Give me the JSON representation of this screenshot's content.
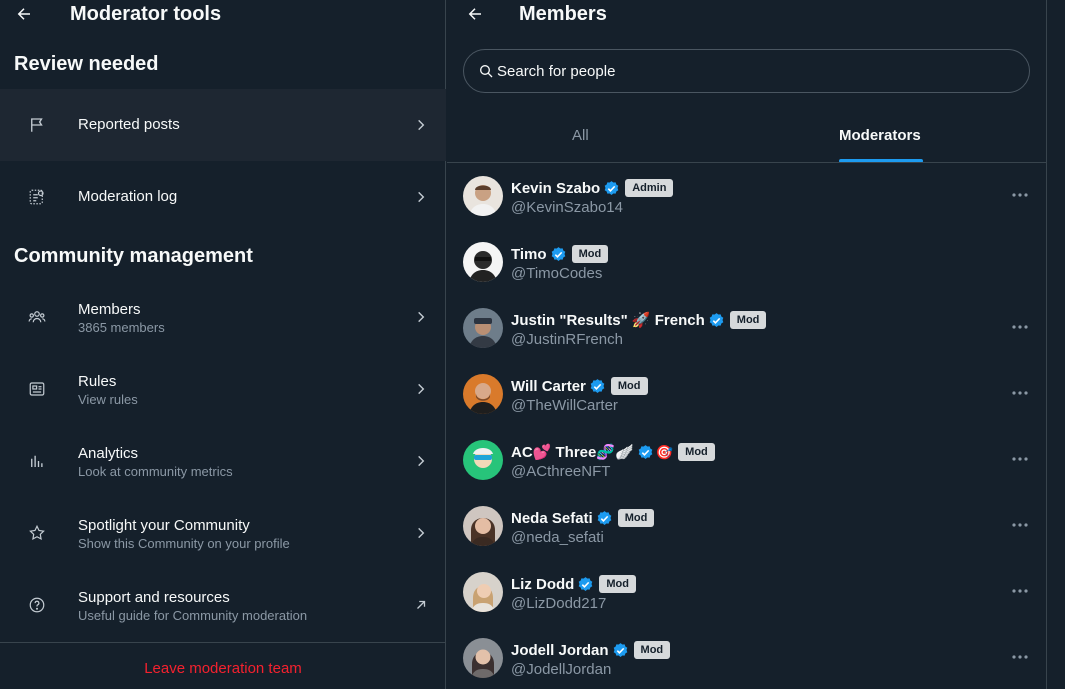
{
  "left": {
    "title": "Moderator tools",
    "back_icon": "arrow-left-icon",
    "review_heading": "Review needed",
    "review_items": [
      {
        "label": "Reported posts",
        "icon": "flag-icon"
      },
      {
        "label": "Moderation log",
        "icon": "moderation-log-icon"
      }
    ],
    "community_heading": "Community management",
    "community_items": [
      {
        "label": "Members",
        "sub": "3865 members",
        "icon": "members-icon"
      },
      {
        "label": "Rules",
        "sub": "View rules",
        "icon": "rules-icon"
      },
      {
        "label": "Analytics",
        "sub": "Look at community metrics",
        "icon": "analytics-icon"
      },
      {
        "label": "Spotlight your Community",
        "sub": "Show this Community on your profile",
        "icon": "star-icon"
      },
      {
        "label": "Support and resources",
        "sub": "Useful guide for Community moderation",
        "icon": "help-icon"
      }
    ],
    "leave_label": "Leave moderation team"
  },
  "right": {
    "title": "Members",
    "search_placeholder": "Search for people",
    "tabs": [
      {
        "label": "All",
        "active": false
      },
      {
        "label": "Moderators",
        "active": true
      }
    ],
    "members": [
      {
        "name": "Kevin Szabo",
        "handle": "@KevinSzabo14",
        "role": "Admin",
        "show_more": true
      },
      {
        "name": "Timo",
        "handle": "@TimoCodes",
        "role": "Mod",
        "show_more": false
      },
      {
        "name": "Justin \"Results\" 🚀 French",
        "handle": "@JustinRFrench",
        "role": "Mod",
        "show_more": true
      },
      {
        "name": "Will Carter",
        "handle": "@TheWillCarter",
        "role": "Mod",
        "show_more": true
      },
      {
        "name": "AC💕 Three🧬🪽",
        "extra_emoji": "🎯",
        "handle": "@ACthreeNFT",
        "role": "Mod",
        "show_more": true
      },
      {
        "name": "Neda Sefati",
        "handle": "@neda_sefati",
        "role": "Mod",
        "show_more": true
      },
      {
        "name": "Liz Dodd",
        "handle": "@LizDodd217",
        "role": "Mod",
        "show_more": true
      },
      {
        "name": "Jodell Jordan",
        "handle": "@JodellJordan",
        "role": "Mod",
        "show_more": true
      }
    ]
  },
  "colors": {
    "background": "#15202b",
    "accent": "#1d9bf0",
    "danger": "#f4212e",
    "muted": "#8b98a5"
  }
}
